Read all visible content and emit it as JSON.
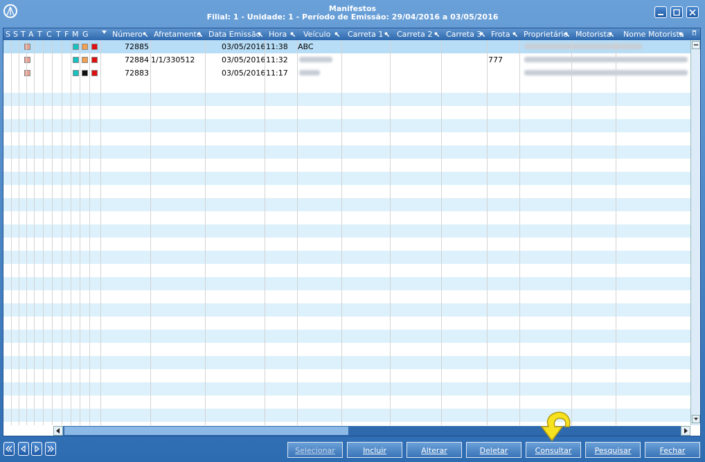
{
  "window": {
    "title_line1": "Manifestos",
    "title_line2": "Filial: 1 - Unidade: 1 - Período de Emissão: 29/04/2016 a 03/05/2016"
  },
  "grid": {
    "flag_headers": [
      "S",
      "S",
      "T",
      "A",
      "T",
      "C",
      "T",
      "F",
      "M",
      "G"
    ],
    "columns": [
      "Número",
      "Afretamento",
      "Data Emissão",
      "Hora",
      "Veículo",
      "Carreta 1",
      "Carreta 2",
      "Carreta 3",
      "Frota",
      "Proprietário",
      "Motorista",
      "Nome Motorista"
    ],
    "rows": [
      {
        "numero": "72885",
        "afretamento": "",
        "data": "03/05/2016",
        "hora": "11:38",
        "veiculo": "ABC",
        "frota": "",
        "colors": [
          "#e8a090",
          "#19c0c0",
          "#f0a050",
          "#e01010"
        ]
      },
      {
        "numero": "72884",
        "afretamento": "1/1/330512",
        "data": "03/05/2016",
        "hora": "11:32",
        "veiculo": "",
        "frota": "777",
        "colors": [
          "#e8a090",
          "#19c0c0",
          "#f0a050",
          "#e01010"
        ]
      },
      {
        "numero": "72883",
        "afretamento": "",
        "data": "03/05/2016",
        "hora": "11:17",
        "veiculo": "",
        "frota": "",
        "colors": [
          "#e8a090",
          "#19c0c0",
          "#101010",
          "#e01010"
        ]
      }
    ]
  },
  "buttons": {
    "selecionar": "Selecionar",
    "incluir": "Incluir",
    "alterar": "Alterar",
    "deletar": "Deletar",
    "consultar": "Consultar",
    "pesquisar": "Pesquisar",
    "fechar": "Fechar"
  },
  "icons": {
    "logo": "app-logo-icon",
    "minimize": "minimize-icon",
    "maximize": "maximize-icon",
    "close": "close-icon",
    "first": "first-record-icon",
    "prev": "prev-record-icon",
    "next": "next-record-icon",
    "last": "last-record-icon",
    "cursor": "yellow-arrow-cursor-icon"
  }
}
